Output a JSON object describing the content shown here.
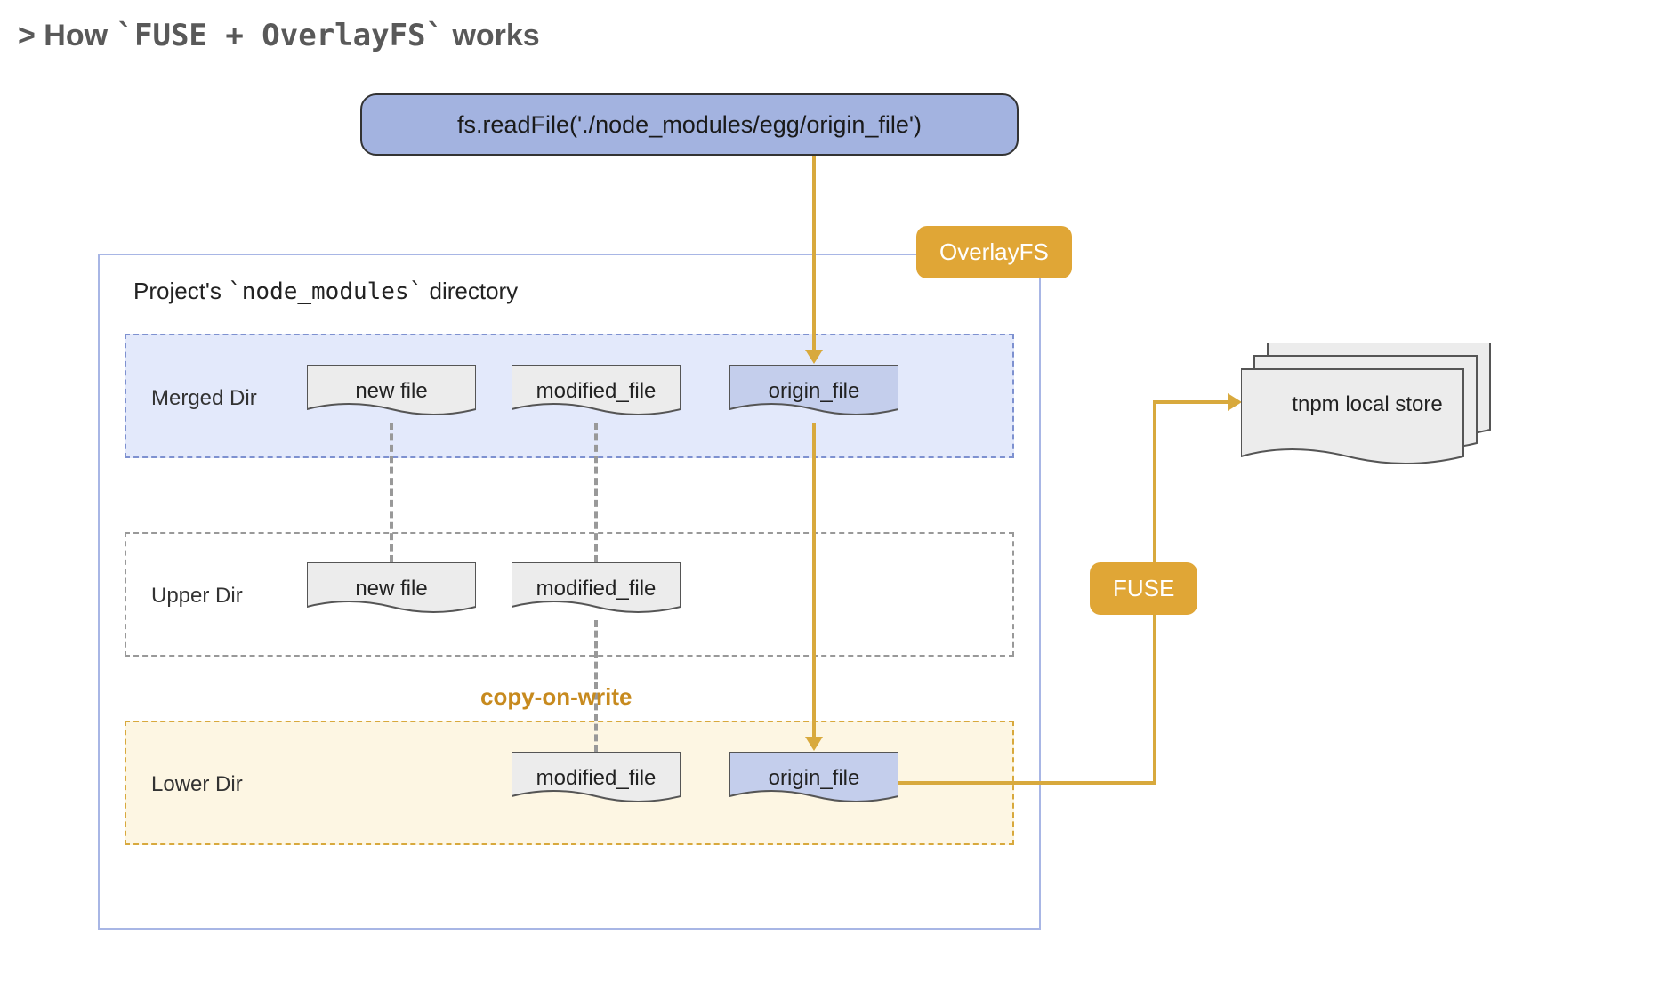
{
  "title_prefix": "> How ",
  "title_code": "`FUSE + OverlayFS`",
  "title_suffix": " works",
  "top_command": "fs.readFile('./node_modules/egg/origin_file')",
  "container_label_prefix": "Project's ",
  "container_label_code": "`node_modules`",
  "container_label_suffix": " directory",
  "layers": {
    "merged": {
      "label": "Merged Dir",
      "files": [
        "new file",
        "modified_file",
        "origin_file"
      ]
    },
    "upper": {
      "label": "Upper Dir",
      "files": [
        "new file",
        "modified_file"
      ]
    },
    "lower": {
      "label": "Lower Dir",
      "files": [
        "modified_file",
        "origin_file"
      ]
    }
  },
  "badges": {
    "overlayfs": "OverlayFS",
    "fuse": "FUSE"
  },
  "copy_on_write": "copy-on-write",
  "store_label": "tnpm local store",
  "colors": {
    "gold": "#d8a93d",
    "blue_node": "#a3b3e0",
    "light_blue_bg": "#e3e9fb",
    "light_yellow_bg": "#fdf6e3",
    "file_grey": "#ececec",
    "file_blue": "#c4ceec"
  }
}
